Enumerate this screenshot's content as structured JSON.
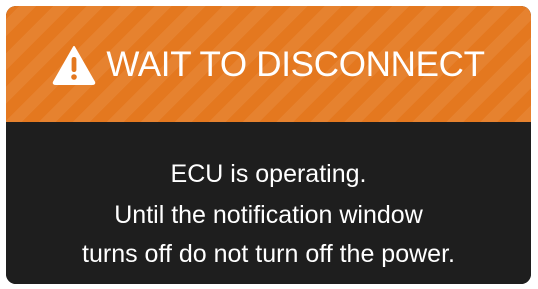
{
  "dialog": {
    "icon": "warning-triangle-icon",
    "title": "WAIT TO DISCONNECT",
    "message_lines": [
      "ECU is operating.",
      "Until the notification window",
      "turns off do not turn off the power."
    ]
  },
  "colors": {
    "header": "#e4781f",
    "body": "#1e1e1e",
    "text": "#ffffff"
  }
}
